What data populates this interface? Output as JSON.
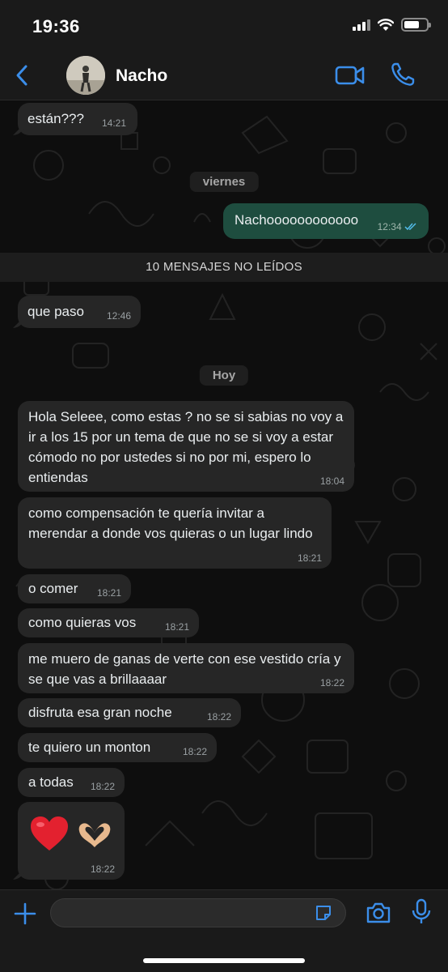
{
  "status_bar": {
    "time": "19:36"
  },
  "header": {
    "contact_name": "Nacho"
  },
  "messages": [
    {
      "dir": "in",
      "text": "están???",
      "time": "14:21"
    },
    {
      "dir": "out",
      "text": "Nachoooooooooooo",
      "time": "12:34"
    },
    {
      "dir": "in",
      "text": "que paso",
      "time": "12:46"
    },
    {
      "dir": "in",
      "text": "Hola Seleee, como estas ? no se si sabias no voy a ir a los 15 por un tema de que no se si voy a estar cómodo no por ustedes si no por mi, espero lo entiendas",
      "time": "18:04"
    },
    {
      "dir": "in",
      "text": "como compensación te quería invitar a merendar a donde vos quieras o un lugar lindo",
      "time": "18:21"
    },
    {
      "dir": "in",
      "text": "o comer",
      "time": "18:21"
    },
    {
      "dir": "in",
      "text": "como quieras vos",
      "time": "18:21"
    },
    {
      "dir": "in",
      "text": "me muero de ganas de verte con ese vestido cría y se que vas a brillaaaar",
      "time": "18:22"
    },
    {
      "dir": "in",
      "text": "disfruta esa gran noche",
      "time": "18:22"
    },
    {
      "dir": "in",
      "text": "te quiero un monton",
      "time": "18:22"
    },
    {
      "dir": "in",
      "text": "a todas",
      "time": "18:22"
    },
    {
      "dir": "in",
      "text": "❤️ 🫶🏼",
      "time": "18:22"
    }
  ],
  "separators": {
    "viernes": "viernes",
    "unread": "10 MENSAJES NO LEÍDOS",
    "hoy": "Hoy"
  },
  "composer": {
    "placeholder": ""
  },
  "colors": {
    "accent": "#3b8eea",
    "outgoing_bubble": "#1e4d3f",
    "incoming_bubble": "#262626",
    "read_ticks": "#53bdeb"
  },
  "icons": [
    "back-chevron-icon",
    "video-call-icon",
    "phone-icon",
    "plus-icon",
    "sticker-icon",
    "camera-icon",
    "microphone-icon"
  ]
}
